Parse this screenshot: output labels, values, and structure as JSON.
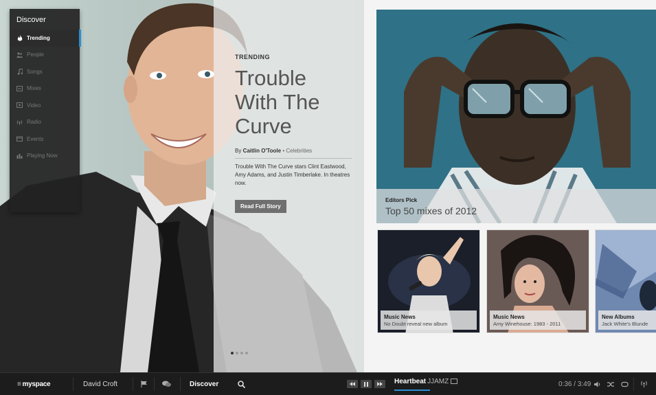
{
  "sidebar": {
    "title": "Discover",
    "items": [
      {
        "label": "Trending",
        "icon": "flame-icon",
        "active": true
      },
      {
        "label": "People",
        "icon": "people-icon",
        "active": false
      },
      {
        "label": "Songs",
        "icon": "music-note-icon",
        "active": false
      },
      {
        "label": "Mixes",
        "icon": "mix-icon",
        "active": false
      },
      {
        "label": "Video",
        "icon": "video-icon",
        "active": false
      },
      {
        "label": "Radio",
        "icon": "radio-icon",
        "active": false
      },
      {
        "label": "Events",
        "icon": "calendar-icon",
        "active": false
      },
      {
        "label": "Playing Now",
        "icon": "equalizer-icon",
        "active": false
      }
    ]
  },
  "hero": {
    "kicker": "TRENDING",
    "title_lines": [
      "Trouble",
      "With The",
      "Curve"
    ],
    "byline_prefix": "By ",
    "author": "Caitlin O'Toole",
    "byline_sep": " • ",
    "category": "Celebrities",
    "summary": "Trouble With The Curve stars Clint Eastwood, Amy Adams, and Justin Timberlake. In theatres now.",
    "cta": "Read Full Story"
  },
  "feature": {
    "kicker": "Editors Pick",
    "title": "Top 50 mixes of 2012"
  },
  "cards": [
    {
      "kicker": "Music News",
      "title": "No Doubt reveal new album"
    },
    {
      "kicker": "Music News",
      "title": "Amy Winehouse: 1983 - 2011"
    },
    {
      "kicker": "New Albums",
      "title": "Jack White's Blunde"
    }
  ],
  "bottombar": {
    "logo": "myspace",
    "user": "David Croft",
    "discover": "Discover",
    "track_title": "Heartbeat",
    "track_artist": "JJAMZ",
    "time": "0:36 / 3:49"
  },
  "colors": {
    "accent": "#2a8fd6",
    "bar": "#1c1c1c",
    "sidebar": "#222222"
  }
}
